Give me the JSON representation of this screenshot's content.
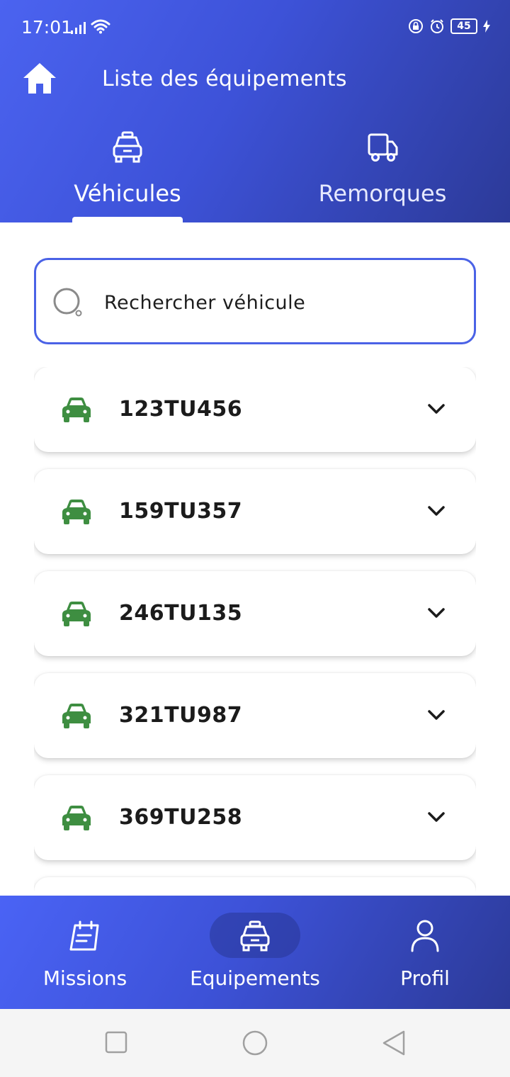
{
  "status_bar": {
    "time": "17:01",
    "battery": "45"
  },
  "header": {
    "title": "Liste des équipements"
  },
  "tabs": [
    {
      "label": "Véhicules",
      "active": true
    },
    {
      "label": "Remorques",
      "active": false
    }
  ],
  "search": {
    "placeholder": "Rechercher véhicule"
  },
  "vehicles": [
    {
      "plate": "123TU456"
    },
    {
      "plate": "159TU357"
    },
    {
      "plate": "246TU135"
    },
    {
      "plate": "321TU987"
    },
    {
      "plate": "369TU258"
    }
  ],
  "bottom_nav": {
    "items": [
      {
        "label": "Missions",
        "icon": "calendar-icon"
      },
      {
        "label": "Equipements",
        "icon": "car-front-icon",
        "active": true
      },
      {
        "label": "Profil",
        "icon": "user-icon"
      }
    ]
  },
  "colors": {
    "accent": "#4a62e6",
    "header_dark": "#2c3a98",
    "vehicle_icon": "#3e8e41",
    "text": "#1b1b1b"
  }
}
